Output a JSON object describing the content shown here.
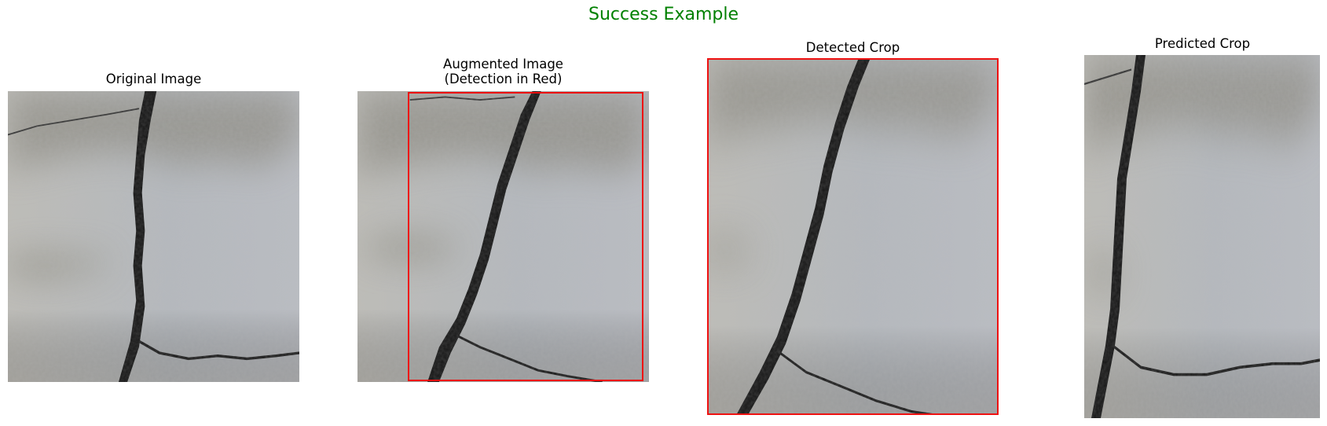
{
  "figure": {
    "title": "Success Example",
    "title_color": "#008000"
  },
  "panels": [
    {
      "title_lines": [
        "Original Image"
      ]
    },
    {
      "title_lines": [
        "Augmented Image",
        "(Detection in Red)"
      ]
    },
    {
      "title_lines": [
        "Detected Crop"
      ]
    },
    {
      "title_lines": [
        "Predicted Crop"
      ]
    }
  ],
  "colors": {
    "detection_box": "#ee1111",
    "concrete_base": "#b7b9b6",
    "crack": "#141414"
  }
}
